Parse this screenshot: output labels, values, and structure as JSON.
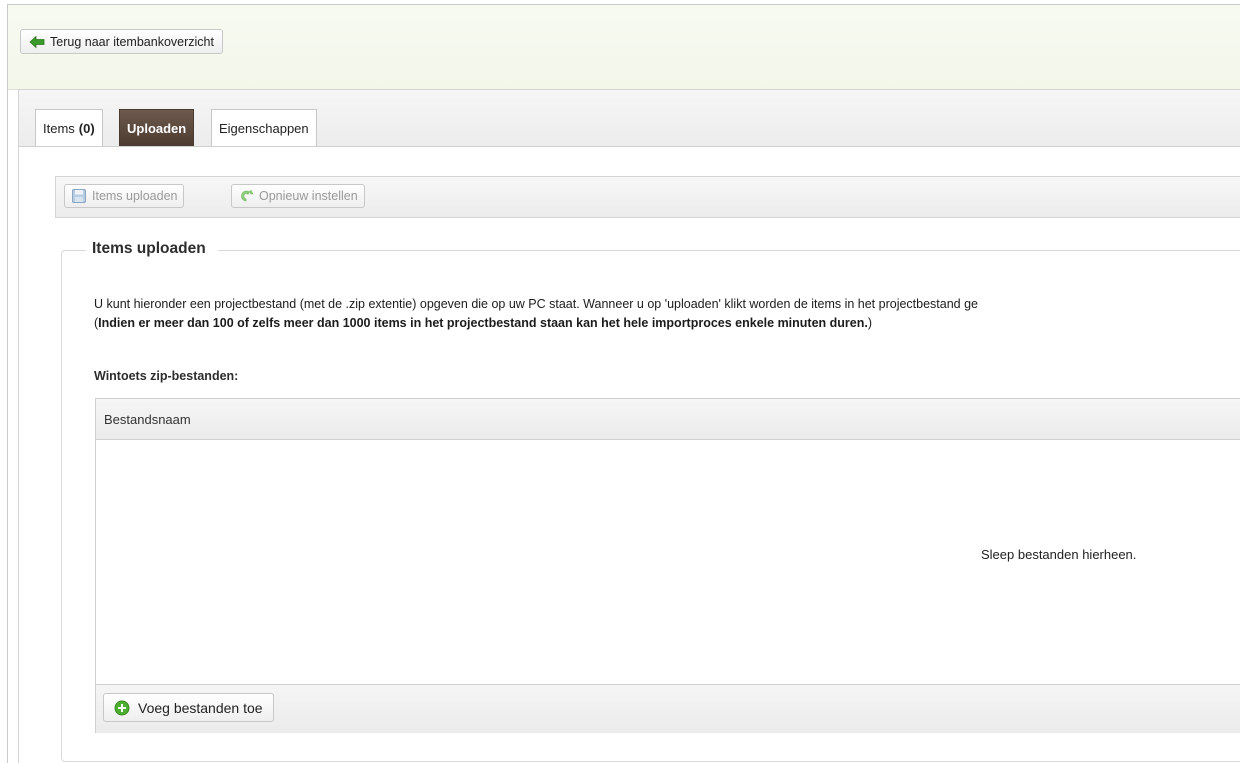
{
  "topbar": {
    "back_label": "Terug naar itembankoverzicht",
    "back_icon": "arrow-left-icon"
  },
  "tabs": [
    {
      "label": "Items",
      "count": "(0)",
      "active": false
    },
    {
      "label": "Uploaden",
      "active": true
    },
    {
      "label": "Eigenschappen",
      "active": false
    }
  ],
  "toolbar": {
    "upload_label": "Items uploaden",
    "upload_icon": "floppy-disk-icon",
    "reset_label": "Opnieuw instellen",
    "reset_icon": "redo-arrow-icon"
  },
  "upload_section": {
    "title": "Items uploaden",
    "description": "U kunt hieronder een projectbestand (met de .zip extentie) opgeven die op uw PC staat. Wanneer u op 'uploaden' klikt worden de items in het projectbestand ge",
    "note_open": "(",
    "note_bold": "Indien er meer dan 100 of zelfs meer dan 1000 items in het projectbestand staan kan het hele importproces enkele minuten duren.",
    "note_close": ")",
    "zip_label": "Wintoets zip-bestanden:",
    "grid": {
      "column_header": "Bestandsnaam",
      "drop_hint": "Sleep bestanden hierheen.",
      "add_label": "Voeg bestanden toe",
      "add_icon": "plus-circle-icon"
    }
  },
  "colors": {
    "active_tab": "#5b4739",
    "back_arrow": "#3a9a2a",
    "add_icon": "#4caf2f"
  }
}
